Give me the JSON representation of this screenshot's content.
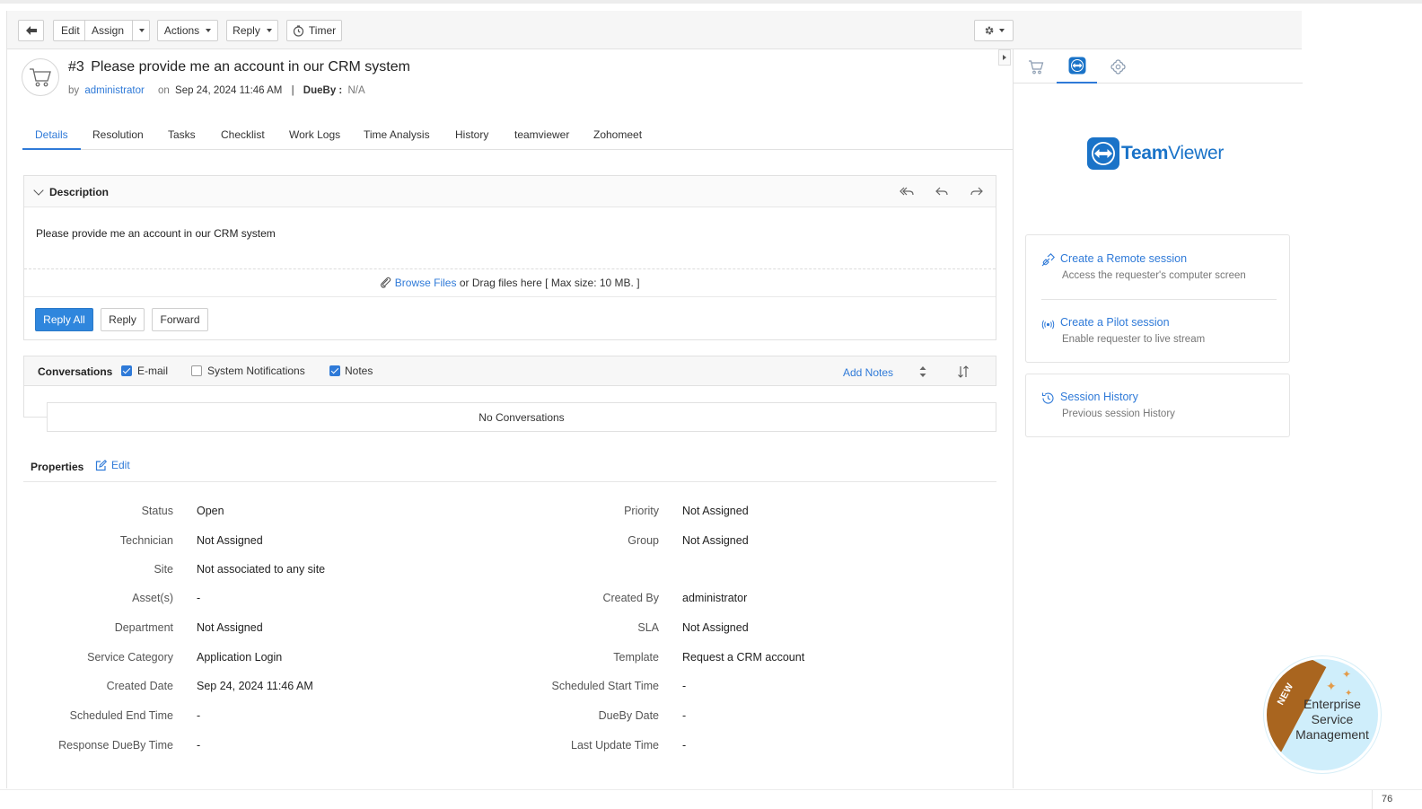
{
  "toolbar": {
    "edit": "Edit",
    "assign": "Assign",
    "actions": "Actions",
    "reply": "Reply",
    "timer": "Timer"
  },
  "request": {
    "number": "#3",
    "title": "Please provide me an account in our CRM system",
    "by_label": "by",
    "author": "administrator",
    "on_label": "on",
    "date": "Sep 24, 2024 11:46 AM",
    "separator": "|",
    "dueby_label": "DueBy :",
    "dueby_value": "N/A"
  },
  "tabs": [
    "Details",
    "Resolution",
    "Tasks",
    "Checklist",
    "Work Logs",
    "Time Analysis",
    "History",
    "teamviewer",
    "Zohomeet"
  ],
  "description": {
    "title": "Description",
    "body": "Please provide me an account in our CRM system",
    "browse": "Browse Files",
    "drag_text": "or Drag files here [ Max size: 10 MB. ]",
    "reply_all": "Reply All",
    "reply": "Reply",
    "forward": "Forward"
  },
  "conversations": {
    "title": "Conversations",
    "email": "E-mail",
    "system_notifications": "System Notifications",
    "notes": "Notes",
    "add_notes": "Add Notes",
    "empty": "No Conversations"
  },
  "properties": {
    "title": "Properties",
    "edit": "Edit",
    "left": [
      {
        "label": "Status",
        "value": "Open"
      },
      {
        "label": "Technician",
        "value": "Not Assigned"
      },
      {
        "label": "Site",
        "value": "Not associated to any site"
      },
      {
        "label": "Asset(s)",
        "value": "-"
      },
      {
        "label": "Department",
        "value": "Not Assigned"
      },
      {
        "label": "Service Category",
        "value": "Application Login"
      },
      {
        "label": "Created Date",
        "value": "Sep 24, 2024 11:46 AM"
      },
      {
        "label": "Scheduled End Time",
        "value": "-"
      },
      {
        "label": "Response DueBy Time",
        "value": "-"
      }
    ],
    "right": [
      {
        "label": "Priority",
        "value": "Not Assigned"
      },
      {
        "label": "Group",
        "value": "Not Assigned"
      },
      {
        "label": "",
        "value": ""
      },
      {
        "label": "Created By",
        "value": "administrator"
      },
      {
        "label": "SLA",
        "value": "Not Assigned"
      },
      {
        "label": "Template",
        "value": "Request a CRM account"
      },
      {
        "label": "Scheduled Start Time",
        "value": "-"
      },
      {
        "label": "DueBy Date",
        "value": "-"
      },
      {
        "label": "Last Update Time",
        "value": "-"
      }
    ]
  },
  "sidebar": {
    "logo_bold": "Team",
    "logo_light": "Viewer",
    "remote": {
      "link": "Create a Remote session",
      "sub": "Access the requester's computer screen"
    },
    "pilot": {
      "link": "Create a Pilot session",
      "sub": "Enable requester to live stream"
    },
    "history": {
      "link": "Session History",
      "sub": "Previous session History"
    }
  },
  "badge": {
    "new": "NEW",
    "line1": "Enterprise",
    "line2": "Service",
    "line3": "Management"
  },
  "footer": {
    "zoom": "76"
  },
  "colors": {
    "accent": "#2f7ad8",
    "primary_button": "#2f86dd",
    "badge_bg": "#cfeefb",
    "ribbon": "#a9651f"
  }
}
